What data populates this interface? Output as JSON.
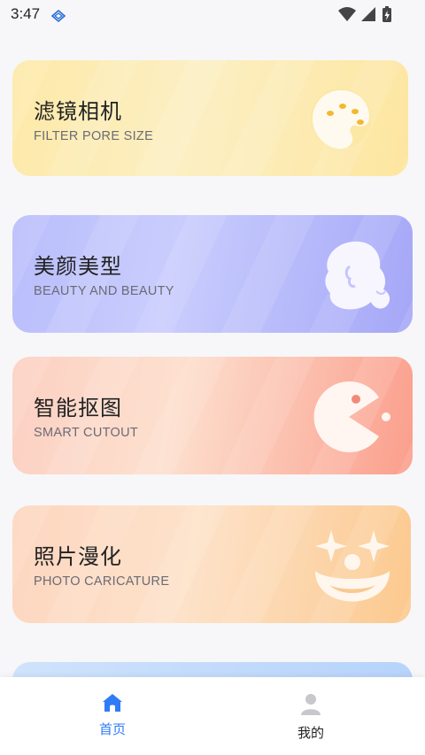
{
  "status": {
    "time": "3:47"
  },
  "cards": [
    {
      "title": "滤镜相机",
      "subtitle": "FILTER PORE SIZE",
      "icon": "palette-icon"
    },
    {
      "title": "美颜美型",
      "subtitle": "BEAUTY AND BEAUTY",
      "icon": "woman-profile-icon"
    },
    {
      "title": "智能抠图",
      "subtitle": "SMART CUTOUT",
      "icon": "pacman-icon"
    },
    {
      "title": "照片漫化",
      "subtitle": "PHOTO CARICATURE",
      "icon": "clown-face-icon"
    }
  ],
  "nav": {
    "home_label": "首页",
    "mine_label": "我的",
    "active_color": "#2f7cf6",
    "inactive_color": "#222222"
  }
}
